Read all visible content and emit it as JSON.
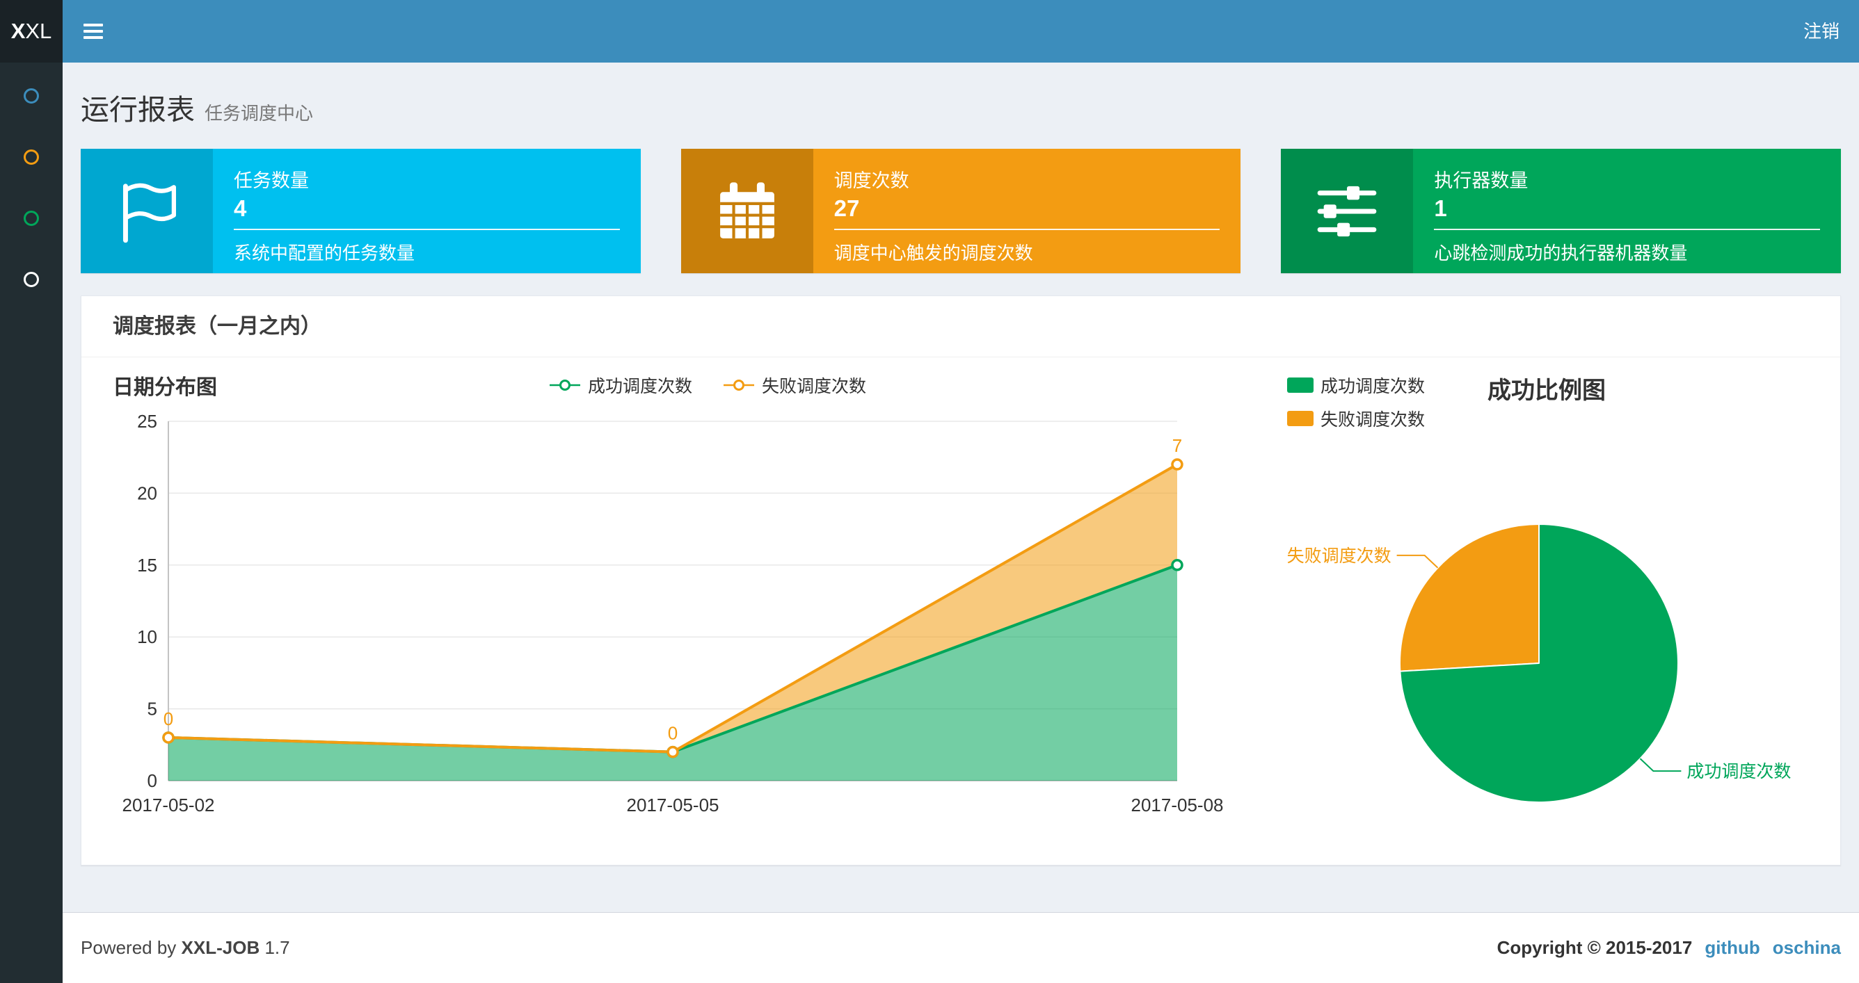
{
  "colors": {
    "navbar": "#3c8dbc",
    "logo_bg": "#1a2226",
    "sidebar_bg": "#222d32",
    "content_bg": "#ecf0f5",
    "success": "#00a65a",
    "fail": "#f39c12",
    "link": "#3c8dbc"
  },
  "navbar": {
    "logo_bold": "X",
    "logo_rest": "XL",
    "logout": "注销"
  },
  "sidebar": {
    "items": [
      {
        "color": "#3c8dbc"
      },
      {
        "color": "#f39c12"
      },
      {
        "color": "#00a65a"
      },
      {
        "color": "#ffffff"
      }
    ]
  },
  "page_header": {
    "title": "运行报表",
    "subtitle": "任务调度中心"
  },
  "info_boxes": [
    {
      "title": "任务数量",
      "value": "4",
      "description": "系统中配置的任务数量",
      "bg": "#00c0ef",
      "icon_bg": "#00a7d0",
      "icon": "flag-icon"
    },
    {
      "title": "调度次数",
      "value": "27",
      "description": "调度中心触发的调度次数",
      "bg": "#f39c12",
      "icon_bg": "#c87f0a",
      "icon": "calendar-icon"
    },
    {
      "title": "执行器数量",
      "value": "1",
      "description": "心跳检测成功的执行器机器数量",
      "bg": "#00a65a",
      "icon_bg": "#008d4c",
      "icon": "sliders-icon"
    }
  ],
  "panel": {
    "title": "调度报表（一月之内）"
  },
  "footer": {
    "powered_prefix": "Powered by",
    "app_name": "XXL-JOB",
    "version": "1.7",
    "copyright": "Copyright © 2015-2017",
    "links": [
      {
        "label": "github"
      },
      {
        "label": "oschina"
      }
    ]
  },
  "chart_data": [
    {
      "type": "area",
      "title": "日期分布图",
      "x": [
        "2017-05-02",
        "2017-05-05",
        "2017-05-08"
      ],
      "series": [
        {
          "name": "成功调度次数",
          "values": [
            3,
            2,
            15
          ],
          "color": "#00a65a"
        },
        {
          "name": "失败调度次数",
          "values": [
            0,
            0,
            7
          ],
          "color": "#f39c12",
          "stacked": true
        }
      ],
      "point_labels": {
        "失败调度次数": [
          "0",
          "0",
          "7"
        ]
      },
      "ylim": [
        0,
        25
      ],
      "yticks": [
        0,
        5,
        10,
        15,
        20,
        25
      ],
      "grid": true,
      "legend_position": "top-center"
    },
    {
      "type": "pie",
      "title": "成功比例图",
      "slices": [
        {
          "name": "成功调度次数",
          "value": 20,
          "color": "#00a65a"
        },
        {
          "name": "失败调度次数",
          "value": 7,
          "color": "#f39c12"
        }
      ],
      "legend_position": "top-left"
    }
  ]
}
